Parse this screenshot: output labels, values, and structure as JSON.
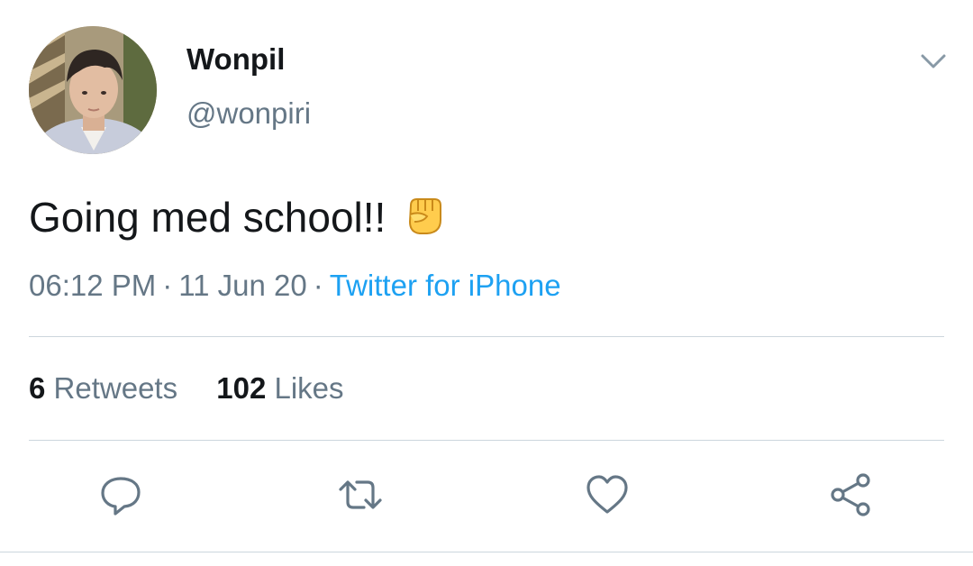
{
  "author": {
    "display_name": "Wonpil",
    "handle": "@wonpiri",
    "avatar_icon": "profile-photo"
  },
  "tweet": {
    "text": "Going med school!!",
    "emoji": "raised-fist-emoji",
    "time": "06:12 PM",
    "separator": "·",
    "date": "11 Jun 20",
    "source": "Twitter for iPhone"
  },
  "stats": {
    "retweets_count": "6",
    "retweets_label": "Retweets",
    "likes_count": "102",
    "likes_label": "Likes"
  },
  "actions": {
    "reply_icon": "reply-icon",
    "retweet_icon": "retweet-icon",
    "like_icon": "heart-icon",
    "share_icon": "share-icon"
  },
  "colors": {
    "text_primary": "#14171a",
    "text_secondary": "#657786",
    "link": "#1da1f2",
    "divider": "#ccd6dd",
    "icon": "#657786"
  }
}
